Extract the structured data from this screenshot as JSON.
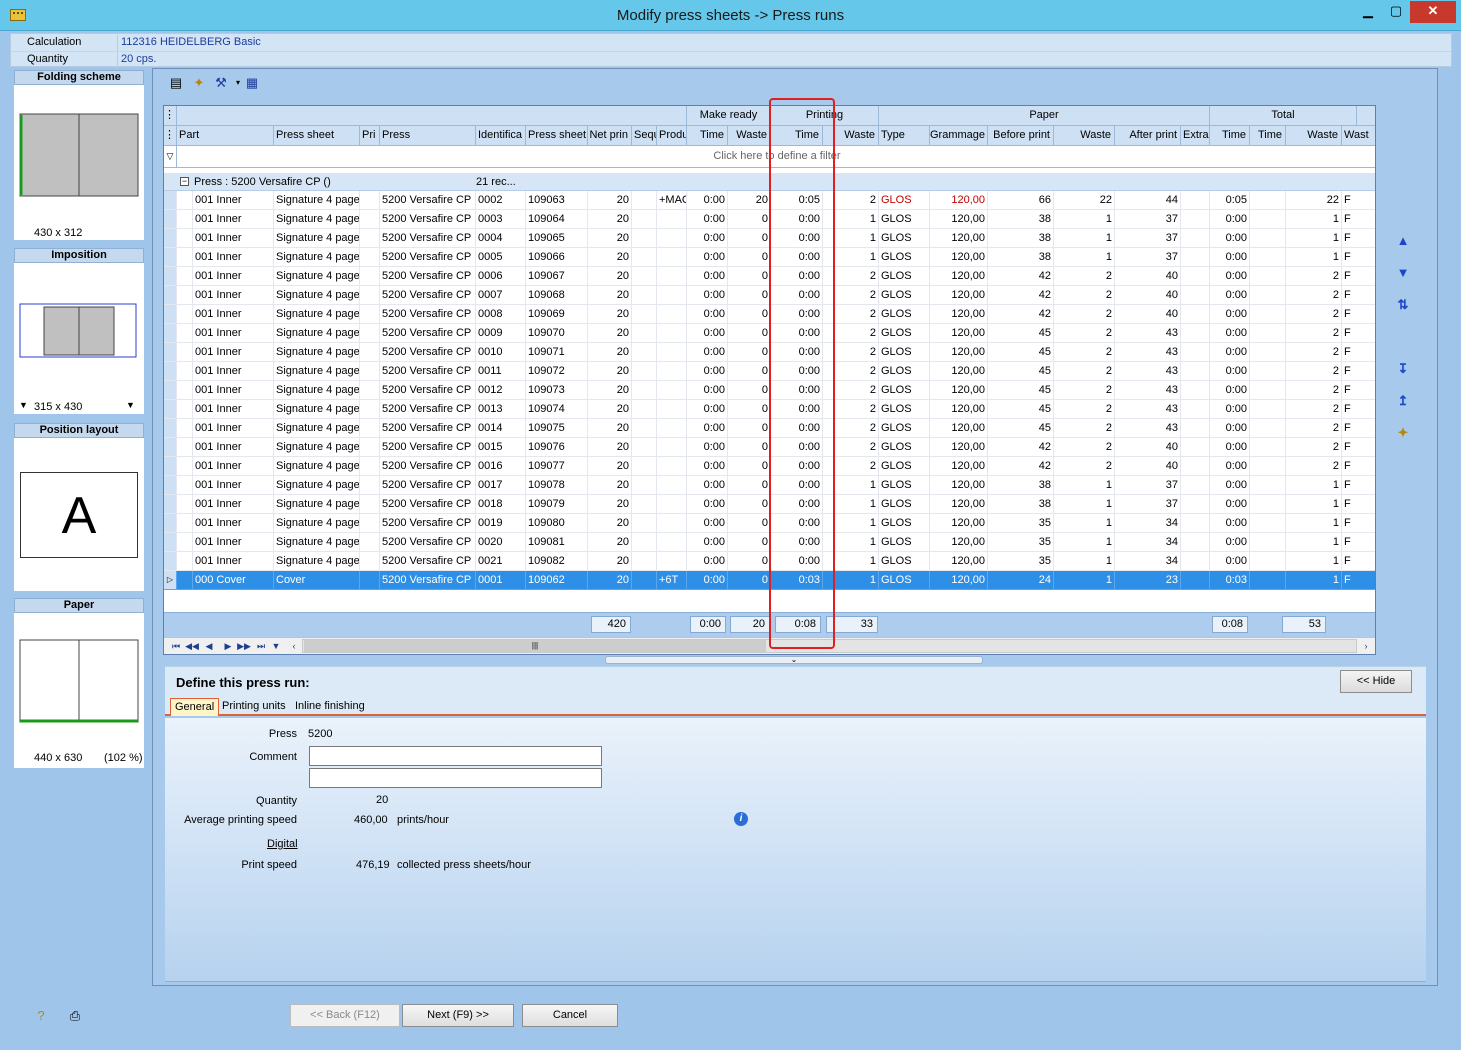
{
  "window": {
    "title": "Modify press sheets -> Press runs",
    "minimize_glyph": "▁",
    "maximize_glyph": "▢",
    "close_glyph": "✕"
  },
  "info": {
    "calculation_label": "Calculation",
    "calculation_value": "112316 HEIDELBERG Basic",
    "quantity_label": "Quantity",
    "quantity_value": "20 cps."
  },
  "left_panel": {
    "folding_scheme": {
      "title": "Folding scheme",
      "size": "430 x 312"
    },
    "imposition": {
      "title": "Imposition",
      "size": "315 x 430"
    },
    "position_layout": {
      "title": "Position layout",
      "letter": "A"
    },
    "paper": {
      "title": "Paper",
      "size": "440 x 630",
      "percent": "(102 %)"
    }
  },
  "grid": {
    "group_headers": {
      "make_ready": "Make ready",
      "printing": "Printing",
      "paper": "Paper",
      "total": "Total"
    },
    "columns": {
      "part": "Part",
      "press_sheet": "Press sheet",
      "pri": "Pri",
      "press": "Press",
      "identifica": "Identifica",
      "press_sheet2": "Press sheet",
      "net_prin": "Net prin",
      "sequ": "Sequ",
      "produ": "Produ",
      "mr_time": "Time",
      "mr_waste": "Waste",
      "pr_time": "Time",
      "pr_waste": "Waste",
      "type": "Type",
      "grammage": "Grammage",
      "before_print": "Before print",
      "pa_waste": "Waste",
      "after_print": "After print",
      "extra": "Extra",
      "t_time1": "Time",
      "t_time2": "Time",
      "t_waste": "Waste",
      "t_wast": "Wast"
    },
    "filter_text": "Click here to define a filter",
    "group_row": {
      "label": "Press : 5200 Versafire CP ()",
      "count": "21 rec..."
    },
    "rows": [
      {
        "part": "001 Inner",
        "sheet": "Signature 4 page",
        "press": "5200 Versafire CP",
        "id": "0002",
        "ps": "109063",
        "net": "20",
        "prod": "+MAC",
        "mrt": "0:00",
        "mrw": "20",
        "prt": "0:05",
        "prw": "2",
        "type": "GLOS",
        "gram": "120,00",
        "before": "66",
        "pw": "22",
        "after": "44",
        "tt": "0:05",
        "tw": "22",
        "f": "F",
        "red": true
      },
      {
        "part": "001 Inner",
        "sheet": "Signature 4 page",
        "press": "5200 Versafire CP",
        "id": "0003",
        "ps": "109064",
        "net": "20",
        "prod": "",
        "mrt": "0:00",
        "mrw": "0",
        "prt": "0:00",
        "prw": "1",
        "type": "GLOS",
        "gram": "120,00",
        "before": "38",
        "pw": "1",
        "after": "37",
        "tt": "0:00",
        "tw": "1",
        "f": "F"
      },
      {
        "part": "001 Inner",
        "sheet": "Signature 4 page",
        "press": "5200 Versafire CP",
        "id": "0004",
        "ps": "109065",
        "net": "20",
        "prod": "",
        "mrt": "0:00",
        "mrw": "0",
        "prt": "0:00",
        "prw": "1",
        "type": "GLOS",
        "gram": "120,00",
        "before": "38",
        "pw": "1",
        "after": "37",
        "tt": "0:00",
        "tw": "1",
        "f": "F"
      },
      {
        "part": "001 Inner",
        "sheet": "Signature 4 page",
        "press": "5200 Versafire CP",
        "id": "0005",
        "ps": "109066",
        "net": "20",
        "prod": "",
        "mrt": "0:00",
        "mrw": "0",
        "prt": "0:00",
        "prw": "1",
        "type": "GLOS",
        "gram": "120,00",
        "before": "38",
        "pw": "1",
        "after": "37",
        "tt": "0:00",
        "tw": "1",
        "f": "F"
      },
      {
        "part": "001 Inner",
        "sheet": "Signature 4 page",
        "press": "5200 Versafire CP",
        "id": "0006",
        "ps": "109067",
        "net": "20",
        "prod": "",
        "mrt": "0:00",
        "mrw": "0",
        "prt": "0:00",
        "prw": "2",
        "type": "GLOS",
        "gram": "120,00",
        "before": "42",
        "pw": "2",
        "after": "40",
        "tt": "0:00",
        "tw": "2",
        "f": "F"
      },
      {
        "part": "001 Inner",
        "sheet": "Signature 4 page",
        "press": "5200 Versafire CP",
        "id": "0007",
        "ps": "109068",
        "net": "20",
        "prod": "",
        "mrt": "0:00",
        "mrw": "0",
        "prt": "0:00",
        "prw": "2",
        "type": "GLOS",
        "gram": "120,00",
        "before": "42",
        "pw": "2",
        "after": "40",
        "tt": "0:00",
        "tw": "2",
        "f": "F"
      },
      {
        "part": "001 Inner",
        "sheet": "Signature 4 page",
        "press": "5200 Versafire CP",
        "id": "0008",
        "ps": "109069",
        "net": "20",
        "prod": "",
        "mrt": "0:00",
        "mrw": "0",
        "prt": "0:00",
        "prw": "2",
        "type": "GLOS",
        "gram": "120,00",
        "before": "42",
        "pw": "2",
        "after": "40",
        "tt": "0:00",
        "tw": "2",
        "f": "F"
      },
      {
        "part": "001 Inner",
        "sheet": "Signature 4 page",
        "press": "5200 Versafire CP",
        "id": "0009",
        "ps": "109070",
        "net": "20",
        "prod": "",
        "mrt": "0:00",
        "mrw": "0",
        "prt": "0:00",
        "prw": "2",
        "type": "GLOS",
        "gram": "120,00",
        "before": "45",
        "pw": "2",
        "after": "43",
        "tt": "0:00",
        "tw": "2",
        "f": "F"
      },
      {
        "part": "001 Inner",
        "sheet": "Signature 4 page",
        "press": "5200 Versafire CP",
        "id": "0010",
        "ps": "109071",
        "net": "20",
        "prod": "",
        "mrt": "0:00",
        "mrw": "0",
        "prt": "0:00",
        "prw": "2",
        "type": "GLOS",
        "gram": "120,00",
        "before": "45",
        "pw": "2",
        "after": "43",
        "tt": "0:00",
        "tw": "2",
        "f": "F"
      },
      {
        "part": "001 Inner",
        "sheet": "Signature 4 page",
        "press": "5200 Versafire CP",
        "id": "0011",
        "ps": "109072",
        "net": "20",
        "prod": "",
        "mrt": "0:00",
        "mrw": "0",
        "prt": "0:00",
        "prw": "2",
        "type": "GLOS",
        "gram": "120,00",
        "before": "45",
        "pw": "2",
        "after": "43",
        "tt": "0:00",
        "tw": "2",
        "f": "F"
      },
      {
        "part": "001 Inner",
        "sheet": "Signature 4 page",
        "press": "5200 Versafire CP",
        "id": "0012",
        "ps": "109073",
        "net": "20",
        "prod": "",
        "mrt": "0:00",
        "mrw": "0",
        "prt": "0:00",
        "prw": "2",
        "type": "GLOS",
        "gram": "120,00",
        "before": "45",
        "pw": "2",
        "after": "43",
        "tt": "0:00",
        "tw": "2",
        "f": "F"
      },
      {
        "part": "001 Inner",
        "sheet": "Signature 4 page",
        "press": "5200 Versafire CP",
        "id": "0013",
        "ps": "109074",
        "net": "20",
        "prod": "",
        "mrt": "0:00",
        "mrw": "0",
        "prt": "0:00",
        "prw": "2",
        "type": "GLOS",
        "gram": "120,00",
        "before": "45",
        "pw": "2",
        "after": "43",
        "tt": "0:00",
        "tw": "2",
        "f": "F"
      },
      {
        "part": "001 Inner",
        "sheet": "Signature 4 page",
        "press": "5200 Versafire CP",
        "id": "0014",
        "ps": "109075",
        "net": "20",
        "prod": "",
        "mrt": "0:00",
        "mrw": "0",
        "prt": "0:00",
        "prw": "2",
        "type": "GLOS",
        "gram": "120,00",
        "before": "45",
        "pw": "2",
        "after": "43",
        "tt": "0:00",
        "tw": "2",
        "f": "F"
      },
      {
        "part": "001 Inner",
        "sheet": "Signature 4 page",
        "press": "5200 Versafire CP",
        "id": "0015",
        "ps": "109076",
        "net": "20",
        "prod": "",
        "mrt": "0:00",
        "mrw": "0",
        "prt": "0:00",
        "prw": "2",
        "type": "GLOS",
        "gram": "120,00",
        "before": "42",
        "pw": "2",
        "after": "40",
        "tt": "0:00",
        "tw": "2",
        "f": "F"
      },
      {
        "part": "001 Inner",
        "sheet": "Signature 4 page",
        "press": "5200 Versafire CP",
        "id": "0016",
        "ps": "109077",
        "net": "20",
        "prod": "",
        "mrt": "0:00",
        "mrw": "0",
        "prt": "0:00",
        "prw": "2",
        "type": "GLOS",
        "gram": "120,00",
        "before": "42",
        "pw": "2",
        "after": "40",
        "tt": "0:00",
        "tw": "2",
        "f": "F"
      },
      {
        "part": "001 Inner",
        "sheet": "Signature 4 page",
        "press": "5200 Versafire CP",
        "id": "0017",
        "ps": "109078",
        "net": "20",
        "prod": "",
        "mrt": "0:00",
        "mrw": "0",
        "prt": "0:00",
        "prw": "1",
        "type": "GLOS",
        "gram": "120,00",
        "before": "38",
        "pw": "1",
        "after": "37",
        "tt": "0:00",
        "tw": "1",
        "f": "F"
      },
      {
        "part": "001 Inner",
        "sheet": "Signature 4 page",
        "press": "5200 Versafire CP",
        "id": "0018",
        "ps": "109079",
        "net": "20",
        "prod": "",
        "mrt": "0:00",
        "mrw": "0",
        "prt": "0:00",
        "prw": "1",
        "type": "GLOS",
        "gram": "120,00",
        "before": "38",
        "pw": "1",
        "after": "37",
        "tt": "0:00",
        "tw": "1",
        "f": "F"
      },
      {
        "part": "001 Inner",
        "sheet": "Signature 4 page",
        "press": "5200 Versafire CP",
        "id": "0019",
        "ps": "109080",
        "net": "20",
        "prod": "",
        "mrt": "0:00",
        "mrw": "0",
        "prt": "0:00",
        "prw": "1",
        "type": "GLOS",
        "gram": "120,00",
        "before": "35",
        "pw": "1",
        "after": "34",
        "tt": "0:00",
        "tw": "1",
        "f": "F"
      },
      {
        "part": "001 Inner",
        "sheet": "Signature 4 page",
        "press": "5200 Versafire CP",
        "id": "0020",
        "ps": "109081",
        "net": "20",
        "prod": "",
        "mrt": "0:00",
        "mrw": "0",
        "prt": "0:00",
        "prw": "1",
        "type": "GLOS",
        "gram": "120,00",
        "before": "35",
        "pw": "1",
        "after": "34",
        "tt": "0:00",
        "tw": "1",
        "f": "F"
      },
      {
        "part": "001 Inner",
        "sheet": "Signature 4 page",
        "press": "5200 Versafire CP",
        "id": "0021",
        "ps": "109082",
        "net": "20",
        "prod": "",
        "mrt": "0:00",
        "mrw": "0",
        "prt": "0:00",
        "prw": "1",
        "type": "GLOS",
        "gram": "120,00",
        "before": "35",
        "pw": "1",
        "after": "34",
        "tt": "0:00",
        "tw": "1",
        "f": "F"
      },
      {
        "part": "000 Cover",
        "sheet": "Cover",
        "press": "5200 Versafire CP",
        "id": "0001",
        "ps": "109062",
        "net": "20",
        "prod": "+6T",
        "mrt": "0:00",
        "mrw": "0",
        "prt": "0:03",
        "prw": "1",
        "type": "GLOS",
        "gram": "120,00",
        "before": "24",
        "pw": "1",
        "after": "23",
        "tt": "0:03",
        "tw": "1",
        "f": "F",
        "selected": true
      }
    ],
    "summary": {
      "net": "420",
      "mr_time": "0:00",
      "mr_waste": "20",
      "pr_time": "0:08",
      "pr_waste": "33",
      "t_time": "0:08",
      "t_waste": "53"
    }
  },
  "define": {
    "title": "Define this press run:",
    "hide_label": "<< Hide",
    "tabs": [
      "General",
      "Printing units",
      "Inline finishing"
    ],
    "press_label": "Press",
    "press_value": "5200",
    "comment_label": "Comment",
    "quantity_label": "Quantity",
    "quantity_value": "20",
    "avg_speed_label": "Average printing speed",
    "avg_speed_value": "460,00",
    "avg_speed_unit": "prints/hour",
    "digital_label": "Digital",
    "print_speed_label": "Print speed",
    "print_speed_value": "476,19",
    "print_speed_unit": "collected press sheets/hour"
  },
  "buttons": {
    "back": "<< Back (F12)",
    "next": "Next (F9) >>",
    "cancel": "Cancel"
  },
  "colors": {
    "accent": "#2e8fe6",
    "highlight": "#e02020",
    "titlebar": "#65c7ea"
  }
}
